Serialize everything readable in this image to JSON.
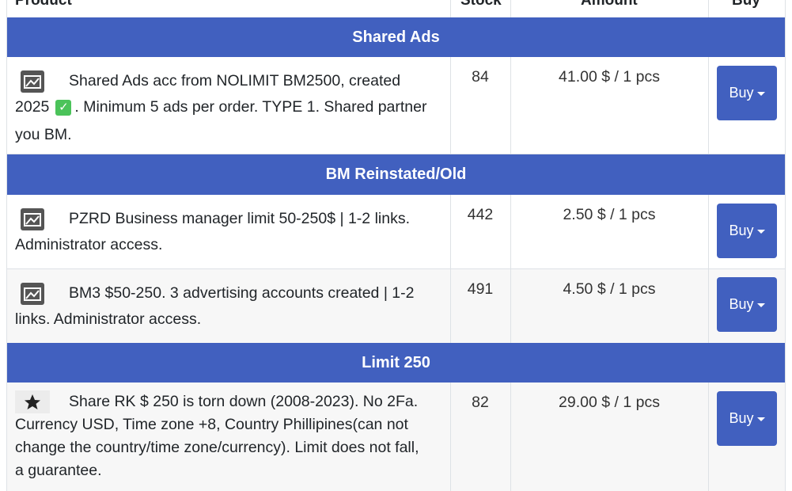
{
  "header": {
    "product": "Product",
    "stock": "Stock",
    "amount": "Amount",
    "buy": "Buy"
  },
  "categories": [
    {
      "title": "Shared Ads"
    },
    {
      "title": "BM Reinstated/Old"
    },
    {
      "title": "Limit 250"
    }
  ],
  "rows": [
    {
      "line1": "Shared Ads acc from NOLIMIT BM2500, created",
      "line2a": "2025",
      "line2b": ". Minimum 5 ads per order. TYPE 1. Shared partner",
      "line3": "you BM.",
      "stock": "84",
      "amount": "41.00 $ / 1 pcs",
      "buy": "Buy",
      "icon": "image-icon"
    },
    {
      "line1": "PZRD Business manager limit 50-250$ | 1-2 links.",
      "line2": "Administrator access.",
      "stock": "442",
      "amount": "2.50 $ / 1 pcs",
      "buy": "Buy",
      "icon": "image-icon"
    },
    {
      "line1": "BM3 $50-250. 3 advertising accounts created | 1-2",
      "line2": "links. Administrator access.",
      "stock": "491",
      "amount": "4.50 $ / 1 pcs",
      "buy": "Buy",
      "icon": "image-icon"
    },
    {
      "line1": "Share RK $ 250 is torn down (2008-2023). No 2Fa.",
      "line2": "Currency USD, Time zone +8, Country Phillipines(can not",
      "line3": "change the country/time zone/currency). Limit does not fall,",
      "line4": "a guarantee.",
      "stock": "82",
      "amount": "29.00 $ / 1 pcs",
      "buy": "Buy",
      "icon": "star-icon"
    }
  ],
  "colors": {
    "accent": "#4160bf",
    "check": "#4bc35a"
  }
}
